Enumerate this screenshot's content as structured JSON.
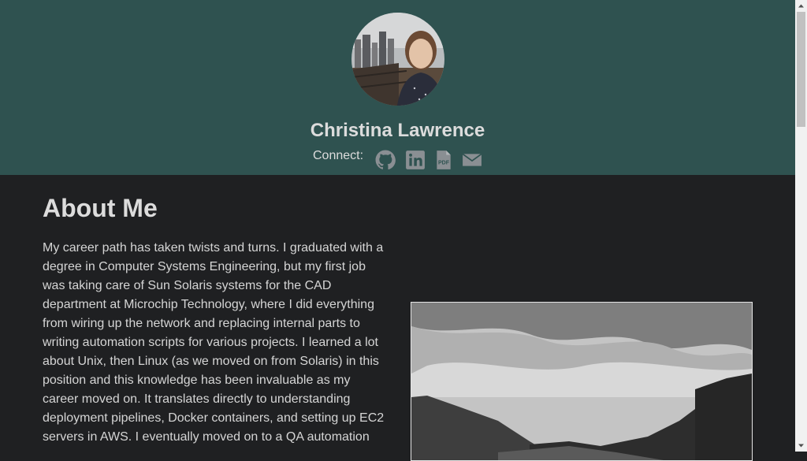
{
  "header": {
    "name": "Christina Lawrence",
    "connect_label": "Connect:",
    "avatar_icon": "profile-photo",
    "social": [
      {
        "icon": "github-icon"
      },
      {
        "icon": "linkedin-icon"
      },
      {
        "icon": "pdf-icon"
      },
      {
        "icon": "envelope-icon"
      }
    ]
  },
  "about": {
    "title": "About Me",
    "paragraph": "My career path has taken twists and turns. I graduated with a degree in Computer Systems Engineering, but my first job was taking care of Sun Solaris systems for the CAD department at Microchip Technology, where I did everything from wiring up the network and replacing internal parts to writing automation scripts for various projects. I learned a lot about Unix, then Linux (as we moved on from Solaris) in this position and this knowledge has been invaluable as my career moved on. It translates directly to understanding deployment pipelines, Docker containers, and setting up EC2 servers in AWS. I eventually moved on to a QA automation"
  },
  "colors": {
    "header_bg": "#2f5250",
    "page_bg": "#1f2022",
    "icon": "#8a8f93",
    "text": "#d9d9d9"
  }
}
